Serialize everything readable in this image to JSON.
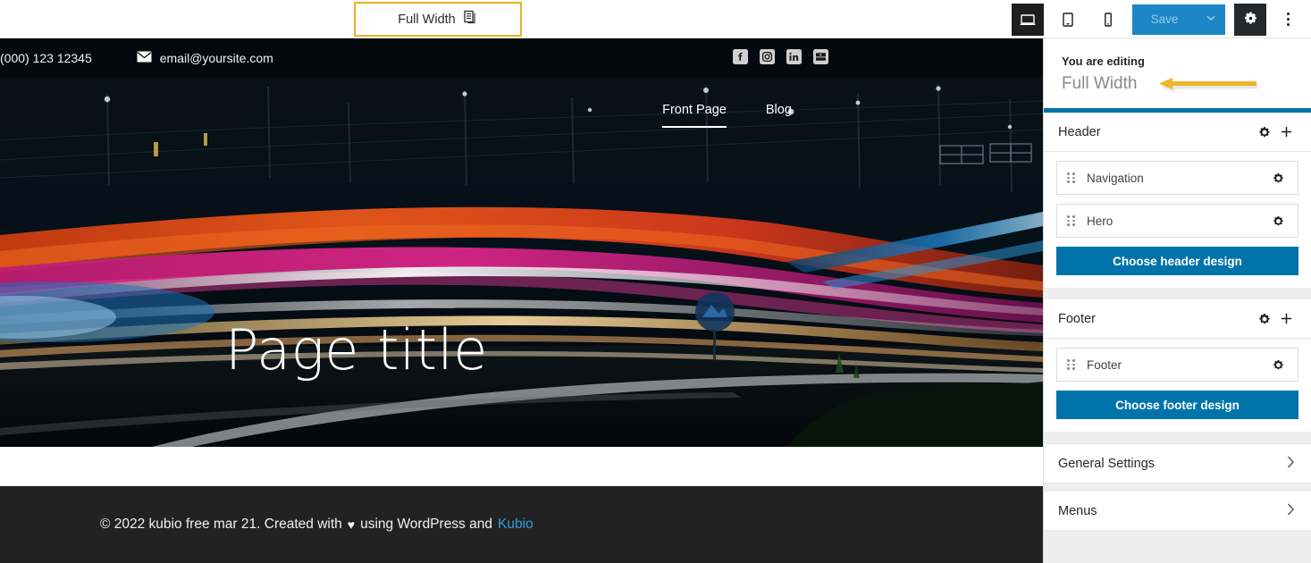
{
  "topbar": {
    "page_pill": {
      "label": "Full Width",
      "icon": "pages-icon"
    },
    "devices": [
      {
        "name": "desktop",
        "icon": "desktop-icon",
        "active": true
      },
      {
        "name": "tablet",
        "icon": "tablet-icon",
        "active": false
      },
      {
        "name": "mobile",
        "icon": "mobile-icon",
        "active": false
      }
    ],
    "save_label": "Save",
    "save_caret_icon": "chevron-down-icon",
    "gear_icon": "gear-icon",
    "kebab_icon": "kebab-menu-icon"
  },
  "preview": {
    "topbar": {
      "phone": "(000) 123 12345",
      "email": "email@yoursite.com",
      "mail_icon": "envelope-icon",
      "social": [
        {
          "name": "facebook-icon",
          "label": "f"
        },
        {
          "name": "instagram-icon",
          "label": ""
        },
        {
          "name": "linkedin-icon",
          "label": "in"
        },
        {
          "name": "youtube-icon",
          "label": ""
        }
      ]
    },
    "nav": [
      {
        "label": "Front Page",
        "active": true
      },
      {
        "label": "Blog",
        "active": false
      }
    ],
    "hero_title": "Page title",
    "footer": {
      "prefix": "© 2022 kubio free mar 21. Created with",
      "heart": "♥",
      "middle": "using WordPress and",
      "link": "Kubio"
    }
  },
  "sidebar": {
    "editing_label": "You are editing",
    "editing_value": "Full Width",
    "annotation_arrow": "left-arrow-annotation",
    "sections": [
      {
        "title": "Header",
        "items": [
          {
            "label": "Navigation"
          },
          {
            "label": "Hero"
          }
        ],
        "button": "Choose header design"
      },
      {
        "title": "Footer",
        "items": [
          {
            "label": "Footer"
          }
        ],
        "button": "Choose footer design"
      }
    ],
    "links": [
      {
        "label": "General Settings"
      },
      {
        "label": "Menus"
      }
    ]
  },
  "colors": {
    "accent_blue": "#0073aa",
    "save_blue": "#1b87c5",
    "highlight_gold": "#e8b423",
    "arrow_gold": "#efb52b",
    "footer_dark": "#222222",
    "link_blue": "#33a0e0"
  }
}
